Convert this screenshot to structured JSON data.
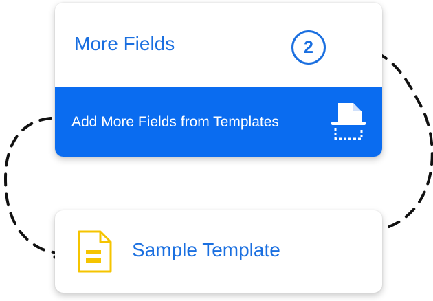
{
  "fields_card": {
    "title": "More Fields",
    "step": "2",
    "add_button_label": "Add More Fields from Templates",
    "add_button_icon": "scan-document-icon"
  },
  "template_card": {
    "label": "Sample Template",
    "icon": "document-icon"
  },
  "colors": {
    "accent_blue": "#1a6fe0",
    "button_blue": "#0a6cf0",
    "document_yellow": "#f5c400",
    "arrow": "#111111"
  }
}
